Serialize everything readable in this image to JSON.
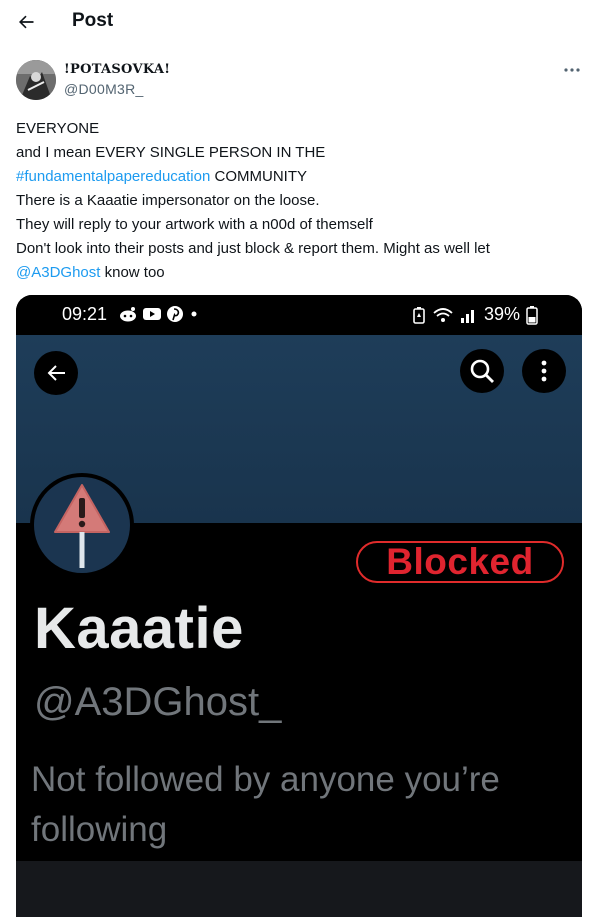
{
  "header": {
    "title": "Post"
  },
  "author": {
    "display_name": "!POTASOVKA!",
    "handle": "@D00M3R_"
  },
  "tweet": {
    "line1": "EVERYONE",
    "line2": "and I mean EVERY SINGLE PERSON IN THE",
    "hashtag": "#fundamentalpapereducation",
    "line3_rest": " COMMUNITY",
    "line4": "There is a Kaaatie impersonator on the loose.",
    "line5": "They will reply to your artwork with a n00d of themself",
    "line6": "Don't look into their posts and just block & report them. Might as well let",
    "mention": "@A3DGhost",
    "line7_rest": " know too"
  },
  "media": {
    "status_time": "09:21",
    "status_battery": "39%",
    "status_icons": [
      "reddit-icon",
      "youtube-icon",
      "pinterest-icon",
      "dot-icon"
    ],
    "blocked_label": "Blocked",
    "profile_name": "Kaaatie",
    "profile_handle": "@A3DGhost_",
    "follow_status": "Not followed by anyone you’re following"
  },
  "colors": {
    "link": "#1d9bf0",
    "banner": "#1e3d59",
    "blocked": "#e0242f",
    "warning_triangle": "#d47a78"
  }
}
